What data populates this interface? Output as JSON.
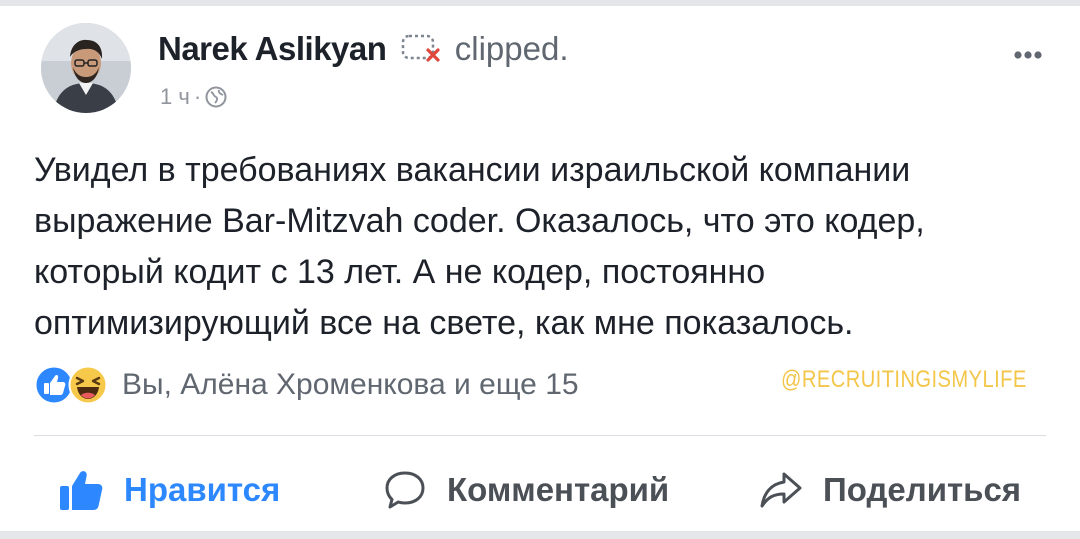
{
  "post": {
    "author_name": "Narek Aslikyan",
    "action": "clipped.",
    "time": "1 ч",
    "separator": "·",
    "text_lines": [
      "Увидел в требованиях вакансии израильской компании",
      "выражение Bar-Mitzvah coder. Оказалось, что это кодер,",
      "который кодит с 13 лет. А не кодер, постоянно",
      "оптимизирующий все на свете, как мне показалось."
    ]
  },
  "reactions": {
    "icons": [
      "like-icon",
      "haha-icon"
    ],
    "summary": "Вы, Алёна Хроменкова и еще 15"
  },
  "watermark": "@RECRUITINGISMYLIFE",
  "actions": {
    "like": "Нравится",
    "comment": "Комментарий",
    "share": "Поделиться"
  },
  "colors": {
    "like_blue": "#2d88ff",
    "text_dark": "#1d2129",
    "text_secondary": "#606770",
    "meta_gray": "#90949c",
    "watermark_yellow": "#f3c64a",
    "divider": "#dadde1"
  }
}
